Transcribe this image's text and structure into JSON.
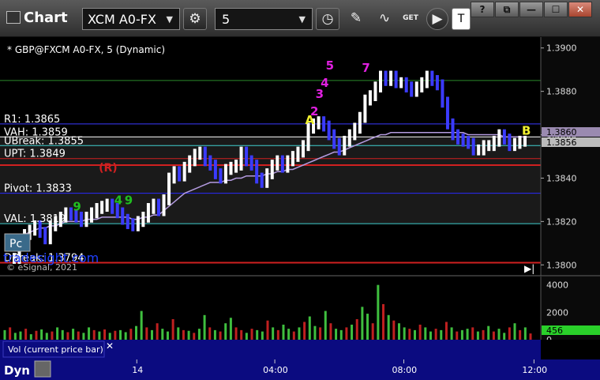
{
  "window": {
    "title": "Chart"
  },
  "toolbar": {
    "symbol": "XCM A0-FX",
    "interval": "5",
    "get_label": "GET",
    "win_help": "?",
    "win_restore": "⧉",
    "win_min": "—",
    "win_max": "☐",
    "win_close": "✕"
  },
  "colors": {
    "background": "#000000",
    "plot_bg": "#151515",
    "bar": "#ffffff",
    "bar_down": "#3b3bff",
    "ma_line": "#b49be0",
    "footer": "#0b0b80",
    "vol_up": "#3fbf3f",
    "vol_down": "#c02020"
  },
  "chart_data": {
    "type": "line",
    "title": "* GBP@FXCM A0-FX, 5 (Dynamic)",
    "ylim": [
      1.3795,
      1.3905
    ],
    "yticks": [
      "1.3900",
      "1.3880",
      "1.3860",
      "1.3840",
      "1.3820",
      "1.3800"
    ],
    "xticks": [
      {
        "label": "14",
        "x": 0.228
      },
      {
        "label": "04:00",
        "x": 0.458
      },
      {
        "label": "08:00",
        "x": 0.673
      },
      {
        "label": "12:00",
        "x": 0.89
      }
    ],
    "levels": [
      {
        "name": "R1",
        "label": "R1: 1.3865",
        "value": 1.3865,
        "color": "#3a3aff"
      },
      {
        "name": "VAH",
        "label": "VAH: 1.3859",
        "value": 1.3859,
        "color": "#ffffff"
      },
      {
        "name": "UBreak",
        "label": "UBreak: 1.3855",
        "value": 1.3855,
        "color": "#40d0d0"
      },
      {
        "name": "UPT",
        "label": "UPT: 1.3849",
        "value": 1.3849,
        "color": "#d02020"
      },
      {
        "name": "Pivot",
        "label": "Pivot: 1.3833",
        "value": 1.3833,
        "color": "#2a2aff"
      },
      {
        "name": "VAL",
        "label": "VAL: 1.3819",
        "value": 1.3819,
        "color": "#40d0d0"
      },
      {
        "name": "DBreak",
        "label": "DBreak: 1.3794",
        "value": 1.3801,
        "color": "#d02020"
      },
      {
        "name": "Top",
        "label": "",
        "value": 1.3885,
        "color": "#2a8a2a"
      },
      {
        "name": "Mid",
        "label": "",
        "value": 1.3846,
        "color": "#d02020"
      }
    ],
    "price": [
      1.3803,
      1.381,
      1.3814,
      1.3816,
      1.3818,
      1.3815,
      1.3812,
      1.3818,
      1.382,
      1.3822,
      1.3824,
      1.3823,
      1.3822,
      1.382,
      1.3822,
      1.3824,
      1.3826,
      1.3827,
      1.3828,
      1.3826,
      1.3824,
      1.3821,
      1.3819,
      1.3818,
      1.382,
      1.3822,
      1.3826,
      1.3828,
      1.3825,
      1.383,
      1.384,
      1.3843,
      1.3841,
      1.3845,
      1.3848,
      1.3851,
      1.3852,
      1.3848,
      1.3846,
      1.3842,
      1.384,
      1.3844,
      1.3845,
      1.3846,
      1.3852,
      1.3848,
      1.3846,
      1.384,
      1.3838,
      1.3842,
      1.3846,
      1.3848,
      1.3845,
      1.3848,
      1.385,
      1.3852,
      1.3855,
      1.3863,
      1.3865,
      1.3866,
      1.3864,
      1.386,
      1.3856,
      1.3853,
      1.3857,
      1.386,
      1.3863,
      1.3868,
      1.3876,
      1.3878,
      1.3882,
      1.3887,
      1.3885,
      1.3887,
      1.3884,
      1.3884,
      1.3882,
      1.388,
      1.3882,
      1.3884,
      1.3887,
      1.3885,
      1.3883,
      1.3875,
      1.3865,
      1.386,
      1.3858,
      1.3857,
      1.3856,
      1.3853,
      1.3853,
      1.3855,
      1.3855,
      1.3857,
      1.386,
      1.3858,
      1.3855,
      1.3856,
      1.3857,
      1.3857
    ],
    "ma": [
      1.3812,
      1.3813,
      1.3814,
      1.3815,
      1.3816,
      1.3817,
      1.3817,
      1.3818,
      1.3818,
      1.3819,
      1.382,
      1.382,
      1.382,
      1.382,
      1.3821,
      1.3821,
      1.3821,
      1.3822,
      1.3822,
      1.3822,
      1.3822,
      1.3822,
      1.3822,
      1.3821,
      1.3821,
      1.3822,
      1.3822,
      1.3823,
      1.3823,
      1.3825,
      1.3827,
      1.3829,
      1.3831,
      1.3833,
      1.3834,
      1.3835,
      1.3836,
      1.3837,
      1.3838,
      1.3838,
      1.3838,
      1.3839,
      1.3839,
      1.384,
      1.384,
      1.3841,
      1.3841,
      1.3841,
      1.3841,
      1.3842,
      1.3842,
      1.3843,
      1.3843,
      1.3844,
      1.3844,
      1.3845,
      1.3846,
      1.3847,
      1.3848,
      1.3849,
      1.385,
      1.3851,
      1.3852,
      1.3852,
      1.3853,
      1.3854,
      1.3855,
      1.3856,
      1.3857,
      1.3858,
      1.3859,
      1.386,
      1.386,
      1.3861,
      1.3861,
      1.3861,
      1.3861,
      1.3861,
      1.3861,
      1.3861,
      1.3861,
      1.3861,
      1.3861,
      1.3861,
      1.3861,
      1.3861,
      1.3861,
      1.3861,
      1.386,
      1.386,
      1.386,
      1.386,
      1.386,
      1.386,
      1.386,
      1.3859,
      1.3859,
      1.3859,
      1.3859,
      1.3859
    ],
    "current_price": "1.3856",
    "ma_price": "1.3860",
    "volume": {
      "label": "Vol (current price bar)",
      "ylim": [
        0,
        4500
      ],
      "yticks": [
        "4000",
        "2000",
        "0"
      ],
      "current": "456",
      "values": [
        700,
        900,
        500,
        600,
        800,
        400,
        650,
        750,
        500,
        600,
        900,
        700,
        550,
        800,
        600,
        500,
        900,
        700,
        600,
        750,
        500,
        650,
        700,
        550,
        800,
        1000,
        2100,
        900,
        700,
        1200,
        800,
        600,
        1500,
        900,
        700,
        650,
        500,
        800,
        1800,
        900,
        700,
        600,
        1200,
        1600,
        900,
        700,
        500,
        800,
        700,
        600,
        1400,
        900,
        700,
        1100,
        800,
        600,
        900,
        1300,
        1700,
        1000,
        900,
        2100,
        1200,
        800,
        700,
        900,
        1100,
        1500,
        2400,
        1900,
        1200,
        4000,
        2600,
        1800,
        1400,
        1200,
        900,
        800,
        700,
        1100,
        900,
        600,
        800,
        700,
        1300,
        900,
        600,
        700,
        800,
        900,
        600,
        700,
        1000,
        600,
        800,
        500,
        900,
        1200,
        700,
        900,
        456
      ],
      "up": [
        1,
        0,
        1,
        1,
        0,
        1,
        0,
        1,
        1,
        0,
        1,
        1,
        0,
        1,
        0,
        1,
        1,
        0,
        1,
        0,
        1,
        0,
        1,
        1,
        0,
        1,
        1,
        0,
        1,
        0,
        1,
        1,
        0,
        1,
        0,
        1,
        0,
        1,
        1,
        0,
        1,
        0,
        1,
        1,
        0,
        0,
        1,
        0,
        1,
        1,
        0,
        1,
        0,
        1,
        1,
        0,
        1,
        0,
        1,
        1,
        0,
        1,
        0,
        1,
        1,
        0,
        1,
        0,
        1,
        1,
        0,
        1,
        0,
        1,
        0,
        1,
        1,
        0,
        1,
        0,
        1,
        1,
        0,
        1,
        0,
        1,
        0,
        1,
        1,
        0,
        1,
        0,
        1,
        0,
        1,
        1,
        0,
        1,
        0,
        1
      ]
    },
    "annotations": [
      {
        "text": "5",
        "color": "#e020e0",
        "x_idx": 61,
        "price": 1.389
      },
      {
        "text": "4",
        "color": "#e020e0",
        "x_idx": 60,
        "price": 1.3882
      },
      {
        "text": "3",
        "color": "#e020e0",
        "x_idx": 59,
        "price": 1.3877
      },
      {
        "text": "2",
        "color": "#e020e0",
        "x_idx": 58,
        "price": 1.3869
      },
      {
        "text": "A",
        "color": "#f0f030",
        "x_idx": 57,
        "price": 1.3865
      },
      {
        "text": "7",
        "color": "#e020e0",
        "x_idx": 68,
        "price": 1.3889
      },
      {
        "text": "B",
        "color": "#f0f030",
        "x_idx": 99,
        "price": 1.386
      },
      {
        "text": "(R)",
        "color": "#d02020",
        "x_idx": 17,
        "price": 1.3843
      },
      {
        "text": "4",
        "color": "#20c020",
        "x_idx": 20,
        "price": 1.3828
      },
      {
        "text": "9",
        "color": "#20c020",
        "x_idx": 22,
        "price": 1.3828
      },
      {
        "text": "9",
        "color": "#20c020",
        "x_idx": 12,
        "price": 1.3825
      }
    ],
    "watermark": "tradesight.com",
    "copyright": "© eSignal, 2021",
    "pc_badge": "Pc"
  },
  "footer": {
    "label": "Dyn"
  }
}
